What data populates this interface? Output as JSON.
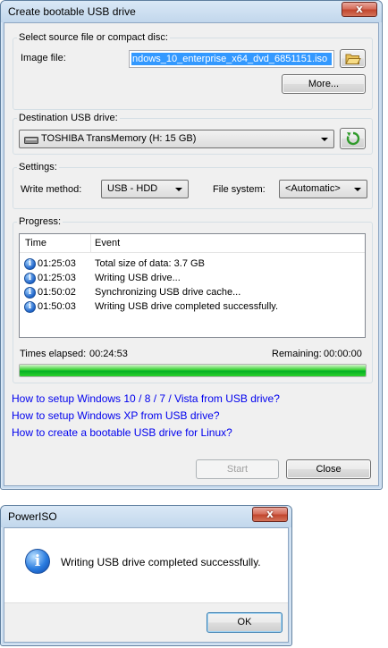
{
  "main_window": {
    "title": "Create bootable USB drive",
    "close_label": "x",
    "source": {
      "group_label": "Select source file or compact disc:",
      "image_file_label": "Image file:",
      "image_file_value": "ndows_10_enterprise_x64_dvd_6851151.iso",
      "more_button": "More..."
    },
    "destination": {
      "group_label": "Destination USB drive:",
      "drive_value": "TOSHIBA TransMemory (H: 15 GB)"
    },
    "settings": {
      "group_label": "Settings:",
      "write_method_label": "Write method:",
      "write_method_value": "USB - HDD",
      "file_system_label": "File system:",
      "file_system_value": "<Automatic>"
    },
    "progress": {
      "group_label": "Progress:",
      "columns": [
        "Time",
        "Event"
      ],
      "rows": [
        {
          "time": "01:25:03",
          "event": "Total size of data: 3.7 GB"
        },
        {
          "time": "01:25:03",
          "event": "Writing USB drive..."
        },
        {
          "time": "01:50:02",
          "event": "Synchronizing USB drive cache..."
        },
        {
          "time": "01:50:03",
          "event": "Writing USB drive completed successfully."
        }
      ],
      "times_elapsed_label": "Times elapsed:",
      "times_elapsed_value": "00:24:53",
      "remaining_label": "Remaining:",
      "remaining_value": "00:00:00",
      "percent": 100
    },
    "links": [
      "How to setup Windows 10 / 8 / 7 / Vista from USB drive?",
      "How to setup Windows XP from USB drive?",
      "How to create a bootable USB drive for Linux?"
    ],
    "start_button": "Start",
    "close_button": "Close"
  },
  "dialog": {
    "title": "PowerISO",
    "close_label": "x",
    "message": "Writing USB drive completed successfully.",
    "ok_button": "OK"
  },
  "icons": {
    "info": "info-icon",
    "folder": "folder-open-icon",
    "refresh": "refresh-icon",
    "drive": "usb-drive-icon"
  },
  "colors": {
    "link": "#0000ee",
    "progress_fill": "#06b025",
    "selection": "#3399ff",
    "close_button": "#c2472f"
  }
}
